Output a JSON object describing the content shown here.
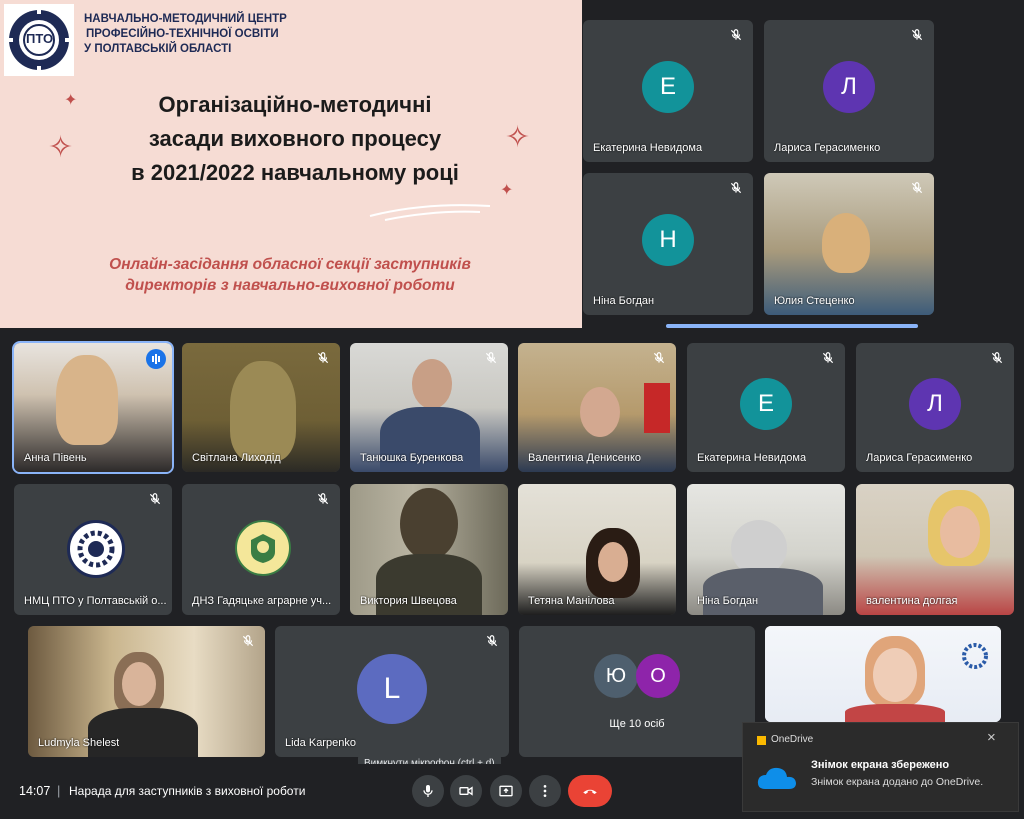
{
  "slide": {
    "org_line1": "НАВЧАЛЬНО-МЕТОДИЧНИЙ ЦЕНТР",
    "org_line2": "ПРОФЕСІЙНО-ТЕХНІЧНОЇ ОСВІТИ",
    "org_line3": "У ПОЛТАВСЬКІЙ ОБЛАСТІ",
    "logo_text": "ПТО",
    "title_line1": "Організаційно-методичні",
    "title_line2": "засади виховного процесу",
    "title_line3": "в 2021/2022 навчальному році",
    "sub_line1": "Онлайн-засідання  обласної секції заступників",
    "sub_line2": "директорів з навчально-виховної роботи"
  },
  "side_tiles": [
    {
      "name": "Екатерина Невидома",
      "initial": "Е"
    },
    {
      "name": "Лариса Герасименко",
      "initial": "Л"
    },
    {
      "name": "Ніна Богдан",
      "initial": "Н"
    },
    {
      "name": "Юлия Стеценко"
    }
  ],
  "grid": [
    {
      "name": "Анна Півень"
    },
    {
      "name": "Світлана Лиходід"
    },
    {
      "name": "Танюшка Буренкова"
    },
    {
      "name": "Валентина Денисенко"
    },
    {
      "name": "Екатерина Невидома",
      "initial": "Е"
    },
    {
      "name": "Лариса Герасименко",
      "initial": "Л"
    },
    {
      "name": "НМЦ ПТО у Полтавській о..."
    },
    {
      "name": "ДНЗ Гадяцьке аграрне уч..."
    },
    {
      "name": "Виктория Швецова"
    },
    {
      "name": "Тетяна Манілова"
    },
    {
      "name": "Ніна Богдан"
    },
    {
      "name": "валентина долгая"
    },
    {
      "name": "Ludmyla Shelest"
    },
    {
      "name": "Lida Karpenko",
      "initial": "L"
    },
    {
      "name": "Ще 10 осіб",
      "initial_a": "Ю",
      "initial_b": "O"
    },
    {
      "name": ""
    }
  ],
  "colors": {
    "teal": "#12939a",
    "purple": "#5e35b1",
    "indigo": "#5c6bc0",
    "slate": "#4e5f6e",
    "magenta": "#8e24aa",
    "red": "#ea4335"
  },
  "bar": {
    "time": "14:07",
    "separator": "|",
    "meeting": "Нарада для заступників з виховної роботи"
  },
  "tooltip": "Вимкнути мікрофон (ctrl + d)",
  "toast": {
    "app": "OneDrive",
    "title": "Знімок екрана збережено",
    "body": "Знімок екрана додано до OneDrive."
  }
}
